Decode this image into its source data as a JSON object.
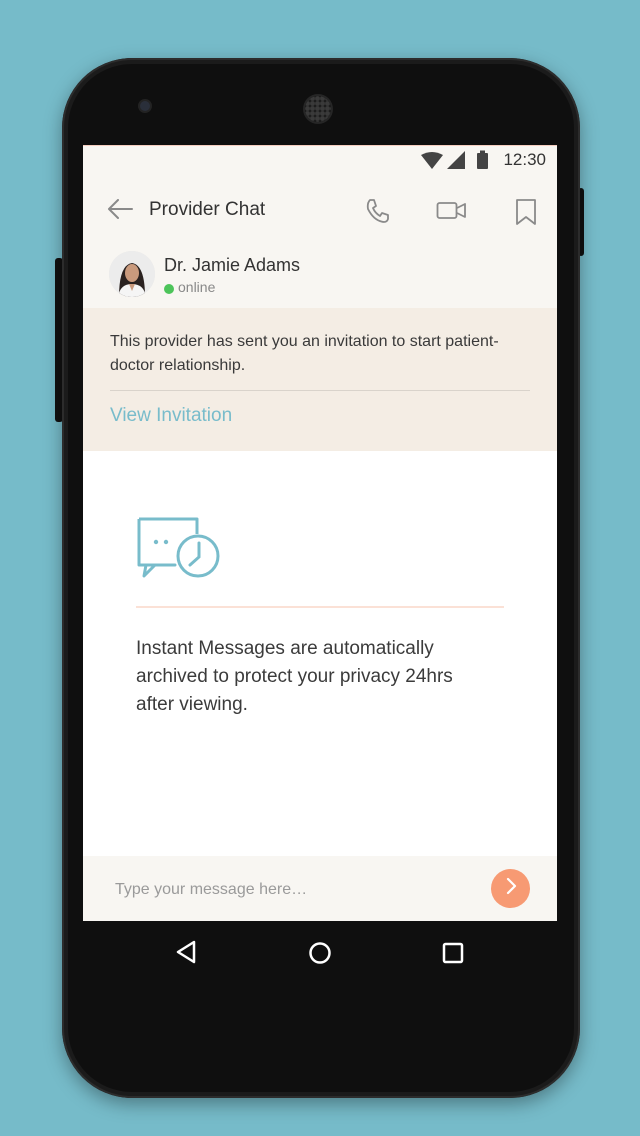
{
  "status_bar": {
    "time": "12:30"
  },
  "header": {
    "title": "Provider Chat"
  },
  "provider": {
    "name": "Dr. Jamie Adams",
    "status": "online",
    "status_color": "#4cc45a"
  },
  "invitation": {
    "message": "This provider has sent you an invitation to start patient-doctor relationship.",
    "link_label": "View Invitation"
  },
  "info": {
    "icon": "chat-clock-icon",
    "text": "Instant Messages are automatically archived to protect your privacy 24hrs after viewing."
  },
  "composer": {
    "placeholder": "Type your message here…"
  },
  "colors": {
    "background": "#76bbc9",
    "accent": "#78bccb",
    "send_button": "#f79a73",
    "invite_background": "#f4ede4"
  }
}
